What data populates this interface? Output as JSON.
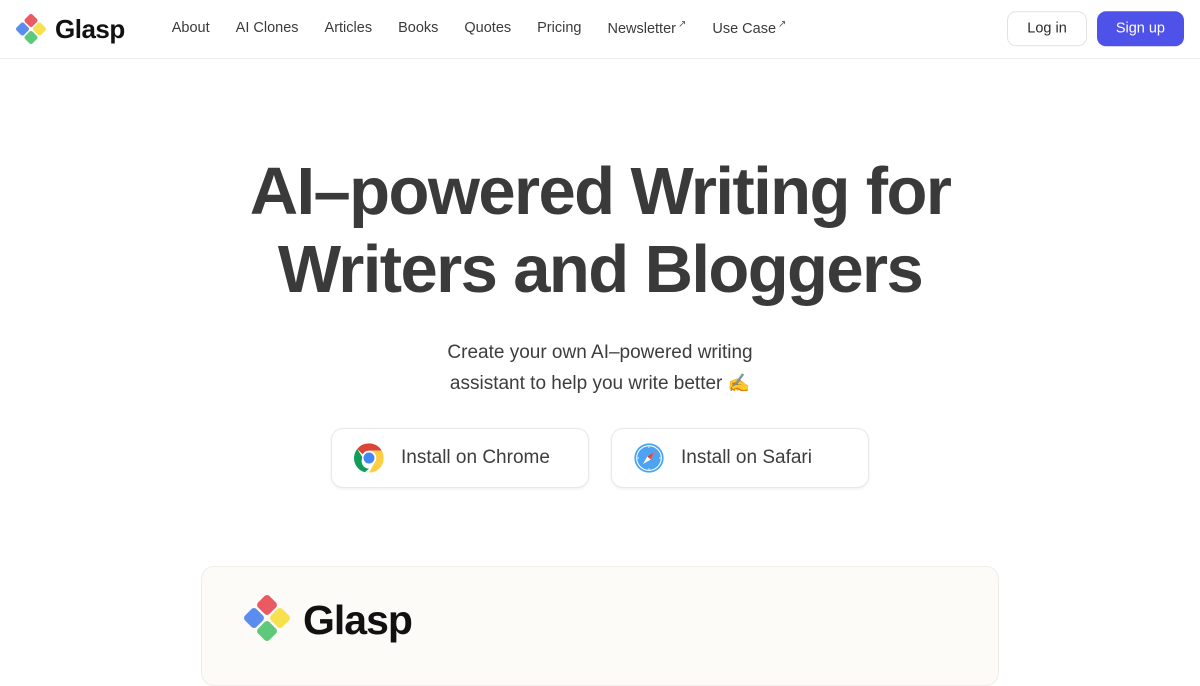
{
  "header": {
    "brand": {
      "name": "Glasp",
      "logo_icon": "glasp-diamond-logo"
    },
    "nav": [
      {
        "label": "About",
        "external": false
      },
      {
        "label": "AI Clones",
        "external": false
      },
      {
        "label": "Articles",
        "external": false
      },
      {
        "label": "Books",
        "external": false
      },
      {
        "label": "Quotes",
        "external": false
      },
      {
        "label": "Pricing",
        "external": false
      },
      {
        "label": "Newsletter",
        "external": true
      },
      {
        "label": "Use Case",
        "external": true
      }
    ],
    "external_arrow_glyph": "↗",
    "auth": {
      "login_label": "Log in",
      "signup_label": "Sign up",
      "signup_color": "#4f52e8"
    }
  },
  "hero": {
    "title_line1": "AI–powered Writing for",
    "title_line2": "Writers and Bloggers",
    "subtitle_line1": "Create your own AI–powered writing",
    "subtitle_line2": "assistant to help you write better",
    "subtitle_emoji": "✍",
    "cta": [
      {
        "label": "Install on Chrome",
        "icon": "chrome-icon"
      },
      {
        "label": "Install on Safari",
        "icon": "safari-icon"
      }
    ]
  },
  "promo_card": {
    "brand_name": "Glasp",
    "logo_icon": "glasp-diamond-logo",
    "background_color": "#fdfbf8"
  }
}
